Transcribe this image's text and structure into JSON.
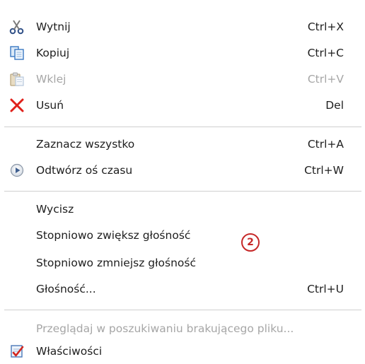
{
  "menu": {
    "items": [
      {
        "label": "Wytnij",
        "shortcut": "Ctrl+X",
        "icon": "scissors-icon",
        "enabled": true
      },
      {
        "label": "Kopiuj",
        "shortcut": "Ctrl+C",
        "icon": "copy-icon",
        "enabled": true
      },
      {
        "label": "Wklej",
        "shortcut": "Ctrl+V",
        "icon": "paste-icon",
        "enabled": false
      },
      {
        "label": "Usuń",
        "shortcut": "Del",
        "icon": "delete-x-icon",
        "enabled": true
      },
      {
        "label": "Zaznacz wszystko",
        "shortcut": "Ctrl+A",
        "icon": "",
        "enabled": true
      },
      {
        "label": "Odtwórz oś czasu",
        "shortcut": "Ctrl+W",
        "icon": "play-icon",
        "enabled": true
      },
      {
        "label": "Wycisz",
        "shortcut": "",
        "icon": "",
        "enabled": true
      },
      {
        "label": "Stopniowo zwiększ głośność",
        "shortcut": "",
        "icon": "",
        "enabled": true
      },
      {
        "label": "Stopniowo zmniejsz głośność",
        "shortcut": "",
        "icon": "",
        "enabled": true
      },
      {
        "label": "Głośność...",
        "shortcut": "Ctrl+U",
        "icon": "",
        "enabled": true
      },
      {
        "label": "Przeglądaj w poszukiwaniu brakującego pliku...",
        "shortcut": "",
        "icon": "",
        "enabled": false
      },
      {
        "label": "Właściwości",
        "shortcut": "",
        "icon": "properties-icon",
        "enabled": true
      }
    ]
  },
  "annotation": {
    "badge": "2"
  },
  "colors": {
    "text": "#1e1e1e",
    "disabled_text": "#a6a6a6",
    "delete_red": "#e0201a",
    "badge_red": "#c62828",
    "separator": "#cfcfcf"
  }
}
